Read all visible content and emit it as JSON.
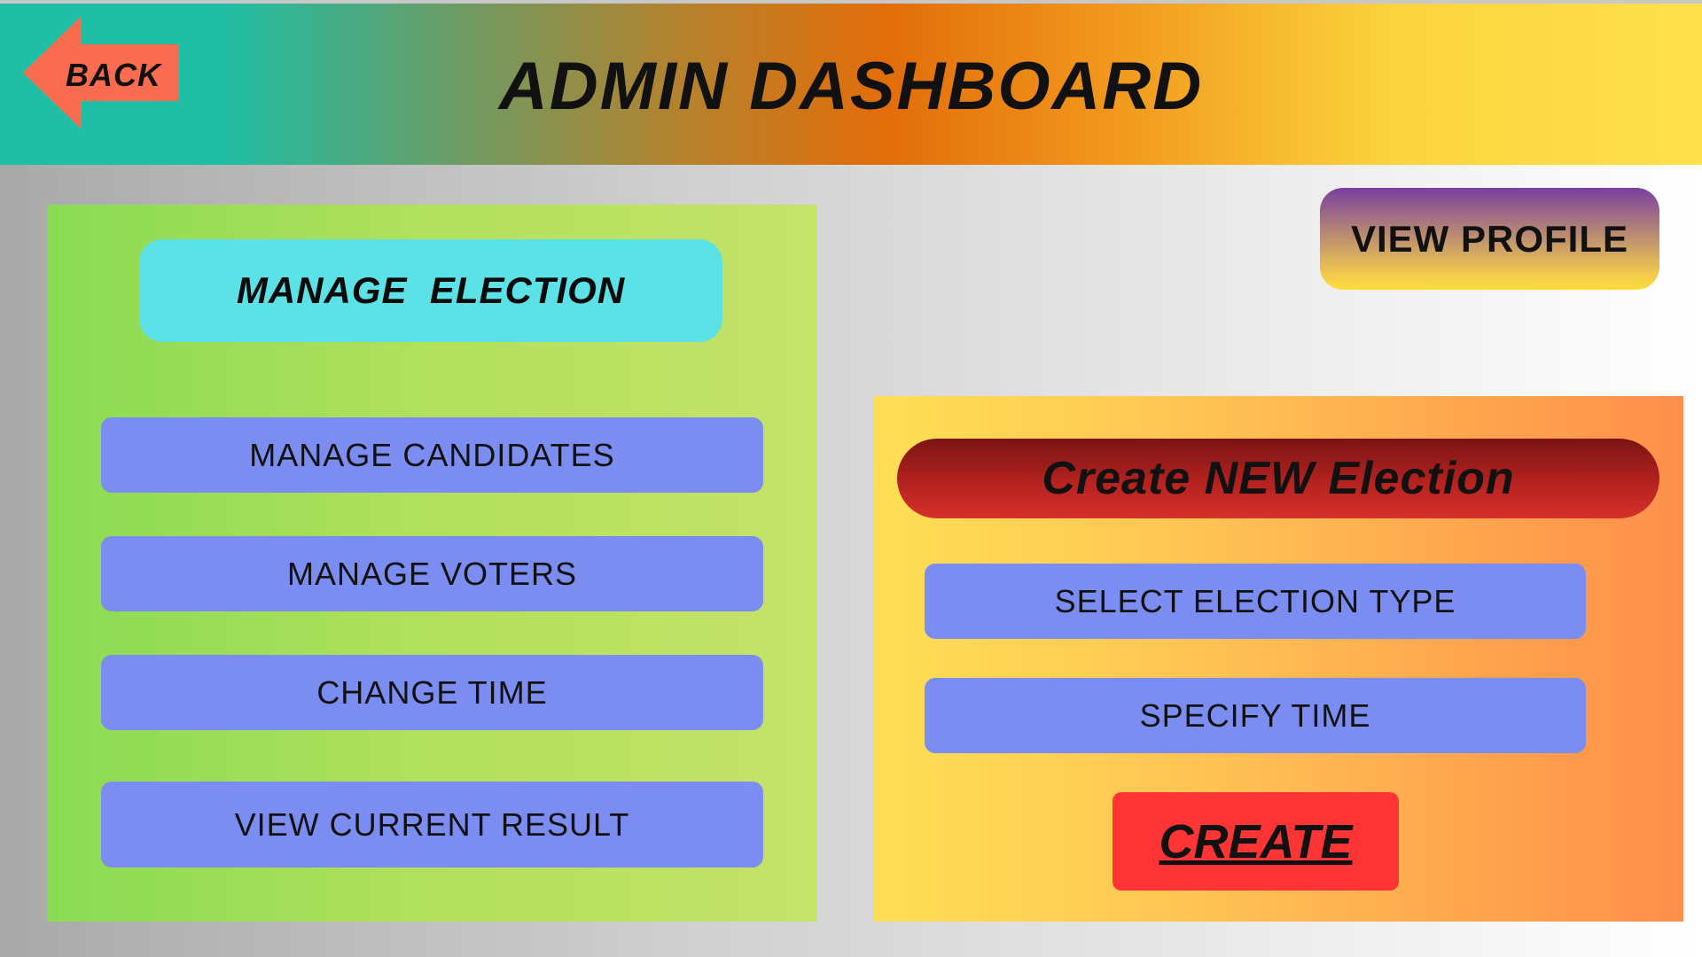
{
  "header": {
    "title": "ADMIN DASHBOARD",
    "back_label": "BACK"
  },
  "left_panel": {
    "manage_election_label": "MANAGE  ELECTION",
    "buttons": [
      {
        "label": "MANAGE CANDIDATES"
      },
      {
        "label": "MANAGE VOTERS"
      },
      {
        "label": "CHANGE TIME"
      },
      {
        "label": "VIEW CURRENT RESULT"
      }
    ]
  },
  "profile": {
    "view_profile_label": "VIEW PROFILE"
  },
  "right_panel": {
    "heading": "Create NEW Election",
    "buttons": [
      {
        "label": "SELECT ELECTION TYPE"
      },
      {
        "label": "SPECIFY TIME"
      }
    ],
    "create_label": "CREATE"
  },
  "colors": {
    "button_blue": "#7b8df0",
    "back_arrow": "#fa6c4f",
    "create_red": "#ff3535",
    "manage_election_cyan": "#5ce1e6"
  },
  "icons": {
    "back": "left-arrow-icon"
  }
}
